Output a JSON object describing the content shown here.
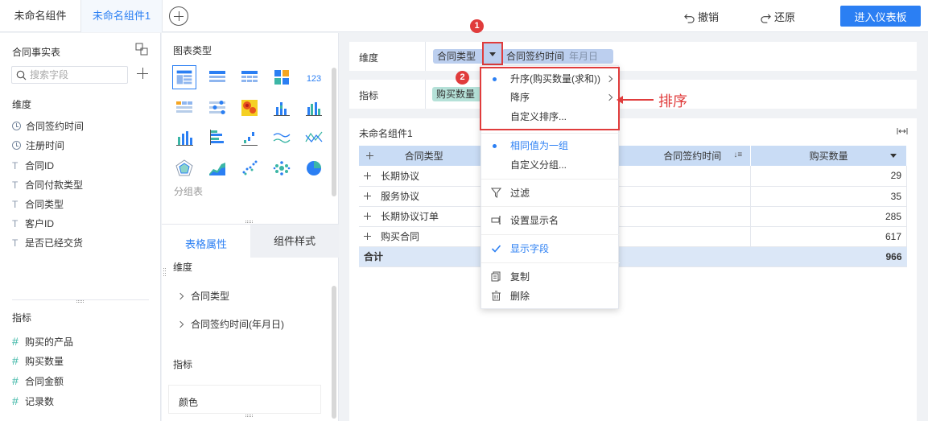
{
  "tabs": [
    {
      "label": "未命名组件"
    },
    {
      "label": "未命名组件1"
    }
  ],
  "topbar": {
    "undo": "撤销",
    "redo": "还原",
    "enter": "进入仪表板"
  },
  "fieldpanel": {
    "title": "合同事实表",
    "search_placeholder": "搜索字段",
    "dimension_label": "维度",
    "dimensions": [
      {
        "label": "合同签约时间",
        "icon": "clock-icon"
      },
      {
        "label": "注册时间",
        "icon": "clock-icon"
      },
      {
        "label": "合同ID",
        "icon": "text-type-icon"
      },
      {
        "label": "合同付款类型",
        "icon": "text-type-icon"
      },
      {
        "label": "合同类型",
        "icon": "text-type-icon"
      },
      {
        "label": "客户ID",
        "icon": "text-type-icon"
      },
      {
        "label": "是否已经交货",
        "icon": "text-type-icon"
      }
    ],
    "indicator_label": "指标",
    "indicators": [
      {
        "label": "购买的产品"
      },
      {
        "label": "购买数量"
      },
      {
        "label": "合同金额"
      },
      {
        "label": "记录数"
      }
    ]
  },
  "charttype": {
    "title": "图表类型",
    "group_label": "分组表",
    "tabs": {
      "table_props": "表格属性",
      "component_style": "组件样式"
    },
    "dimension_label": "维度",
    "dim_items": [
      "合同类型",
      "合同签约时间(年月日)"
    ],
    "indicator_label": "指标",
    "color_label": "颜色"
  },
  "main": {
    "dim_label": "维度",
    "dim_chip1": "合同类型",
    "dim_chip2": "合同签约时间",
    "dim_chip2_sub": "年月日",
    "ind_label": "指标",
    "ind_chip": "购买数量",
    "component_title": "未命名组件1",
    "table": {
      "headers": [
        "合同类型",
        "合同签约时间",
        "购买数量"
      ],
      "rows": [
        {
          "type": "长期协议",
          "value": "29"
        },
        {
          "type": "服务协议",
          "value": "35"
        },
        {
          "type": "长期协议订单",
          "value": "285"
        },
        {
          "type": "购买合同",
          "value": "617"
        }
      ],
      "total_label": "合计",
      "total_value": "966"
    }
  },
  "menu": {
    "asc": "升序(购买数量(求和))",
    "desc": "降序",
    "custom_sort": "自定义排序...",
    "same_group": "相同值为一组",
    "custom_group": "自定义分组...",
    "filter": "过滤",
    "set_display_name": "设置显示名",
    "show_field": "显示字段",
    "copy": "复制",
    "delete": "删除"
  },
  "annotations": {
    "badge1": "1",
    "badge2": "2",
    "label": "排序"
  },
  "colors": {
    "accent": "#2b7ff3",
    "annotation": "#e03c3c",
    "dim_chip": "#bccfef",
    "ind_chip": "#b5e1d8"
  }
}
